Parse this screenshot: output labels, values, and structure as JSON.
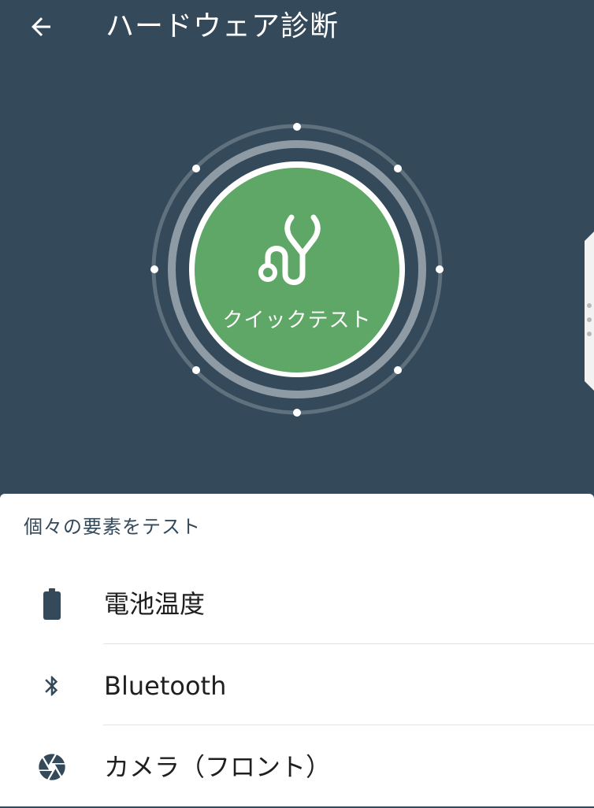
{
  "app_bar": {
    "title": "ハードウェア診断",
    "back_icon": "arrow-left-icon"
  },
  "quick_test": {
    "label": "クイックテスト",
    "icon": "stethoscope-icon"
  },
  "colors": {
    "header_bg": "#34495a",
    "quick_test_green": "#5fa767",
    "sheet_bg": "#ffffff",
    "icon_color": "#34495a"
  },
  "sheet": {
    "section_title": "個々の要素をテスト",
    "items": [
      {
        "label": "電池温度",
        "icon": "battery-icon"
      },
      {
        "label": "Bluetooth",
        "icon": "bluetooth-icon"
      },
      {
        "label": "カメラ（フロント）",
        "icon": "camera-aperture-icon"
      }
    ]
  }
}
